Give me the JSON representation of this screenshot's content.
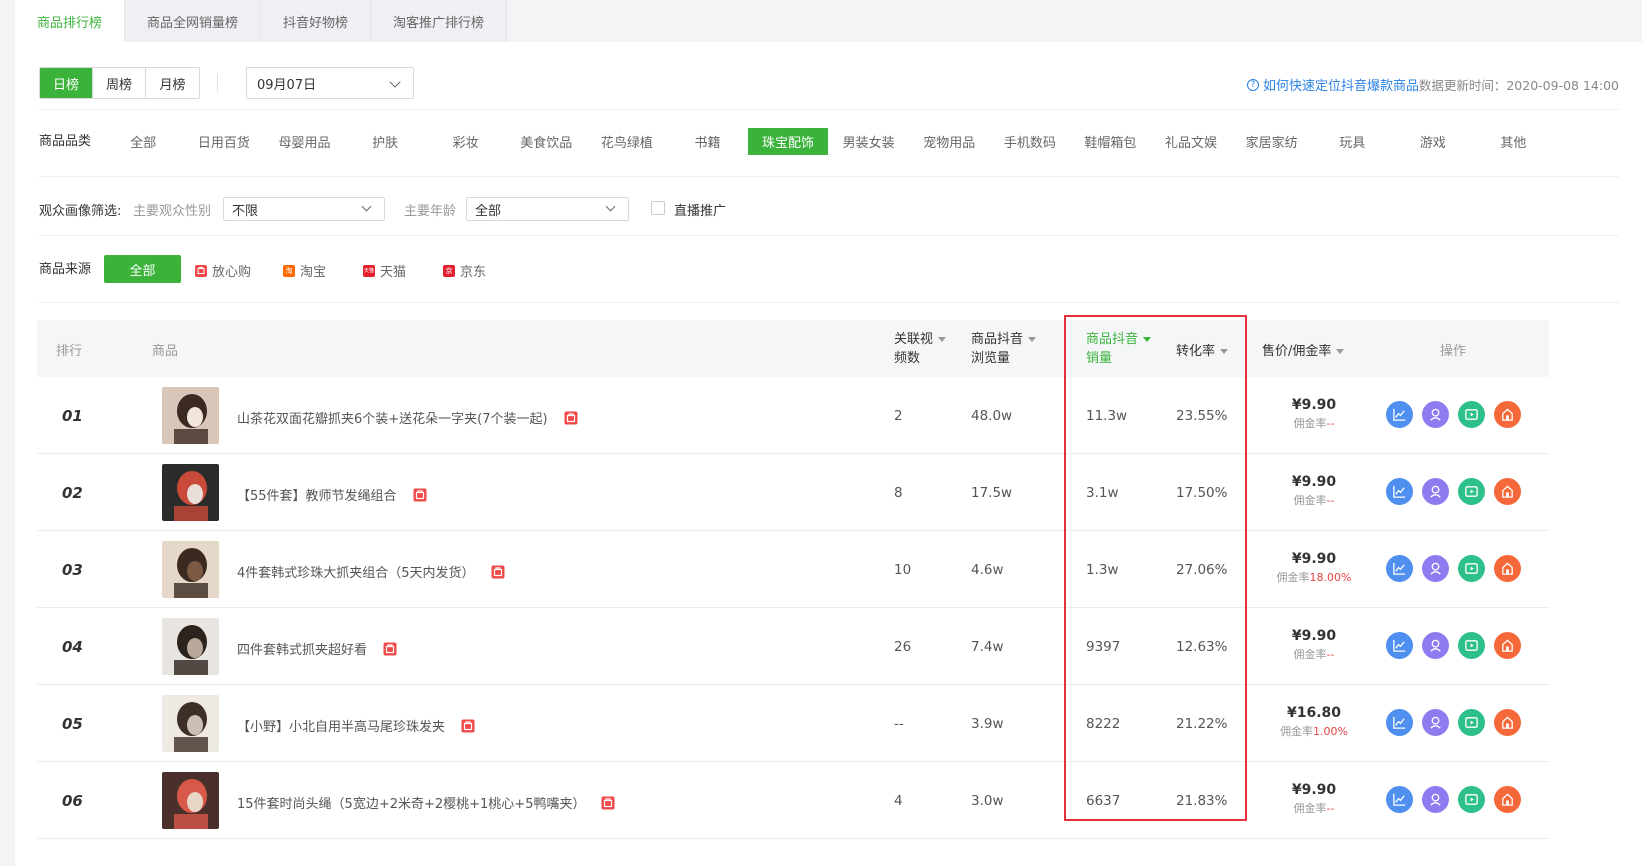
{
  "tabs": [
    "商品排行榜",
    "商品全网销量榜",
    "抖音好物榜",
    "淘客推广排行榜"
  ],
  "period": {
    "day": "日榜",
    "week": "周榜",
    "month": "月榜"
  },
  "date": "09月07日",
  "help_link": "如何快速定位抖音爆款商品",
  "update_time": "数据更新时间：2020-09-08 14:00",
  "category": {
    "label": "商品品类",
    "items": [
      "全部",
      "日用百货",
      "母婴用品",
      "护肤",
      "彩妆",
      "美食饮品",
      "花鸟绿植",
      "书籍",
      "珠宝配饰",
      "男装女装",
      "宠物用品",
      "手机数码",
      "鞋帽箱包",
      "礼品文娱",
      "家居家纺",
      "玩具",
      "游戏",
      "其他"
    ],
    "active_index": 8
  },
  "audience": {
    "label": "观众画像筛选:",
    "gender_label": "主要观众性别",
    "gender_value": "不限",
    "age_label": "主要年龄",
    "age_value": "全部",
    "live_promo": "直播推广"
  },
  "source": {
    "label": "商品来源",
    "all": "全部",
    "items": [
      {
        "name": "放心购",
        "color": "#f04a4a",
        "icon": "bag-icon"
      },
      {
        "name": "淘宝",
        "color": "#ff6a00",
        "icon": "taobao-icon",
        "glyph": "淘"
      },
      {
        "name": "天猫",
        "color": "#e5202e",
        "icon": "tmall-icon",
        "glyph": "天猫"
      },
      {
        "name": "京东",
        "color": "#e5202e",
        "icon": "jd-icon",
        "glyph": "京"
      }
    ]
  },
  "table": {
    "headers": {
      "rank": "排行",
      "product": "商品",
      "videos_l1": "关联视",
      "videos_l2": "频数",
      "views_l1": "商品抖音",
      "views_l2": "浏览量",
      "sales_l1": "商品抖音",
      "sales_l2": "销量",
      "conversion": "转化率",
      "price": "售价/佣金率",
      "ops": "操作"
    },
    "commission_label": "佣金率",
    "rows": [
      {
        "rank": "01",
        "name": "山茶花双面花瓣抓夹6个装+送花朵一字夹(7个装一起)",
        "videos": "2",
        "views": "48.0w",
        "sales": "11.3w",
        "conversion": "23.55%",
        "price": "¥9.90",
        "commission": "--"
      },
      {
        "rank": "02",
        "name": "【55件套】教师节发绳组合",
        "videos": "8",
        "views": "17.5w",
        "sales": "3.1w",
        "conversion": "17.50%",
        "price": "¥9.90",
        "commission": "--"
      },
      {
        "rank": "03",
        "name": "4件套韩式珍珠大抓夹组合（5天内发货）",
        "videos": "10",
        "views": "4.6w",
        "sales": "1.3w",
        "conversion": "27.06%",
        "price": "¥9.90",
        "commission": "18.00%"
      },
      {
        "rank": "04",
        "name": "四件套韩式抓夹超好看",
        "videos": "26",
        "views": "7.4w",
        "sales": "9397",
        "conversion": "12.63%",
        "price": "¥9.90",
        "commission": "--"
      },
      {
        "rank": "05",
        "name": "【小野】小北自用半高马尾珍珠发夹",
        "videos": "--",
        "views": "3.9w",
        "sales": "8222",
        "conversion": "21.22%",
        "price": "¥16.80",
        "commission": "1.00%"
      },
      {
        "rank": "06",
        "name": "15件套时尚头绳（5宽边+2米奇+2樱桃+1桃心+5鸭嘴夹）",
        "videos": "4",
        "views": "3.0w",
        "sales": "6637",
        "conversion": "21.83%",
        "price": "¥9.90",
        "commission": "--"
      }
    ]
  },
  "ops_colors": {
    "trend": "#4f8ff0",
    "audience": "#8c7cf0",
    "video": "#2ec08a",
    "shop": "#f4683a"
  },
  "accent": "#3bb33b",
  "highlight": "#e5323a"
}
